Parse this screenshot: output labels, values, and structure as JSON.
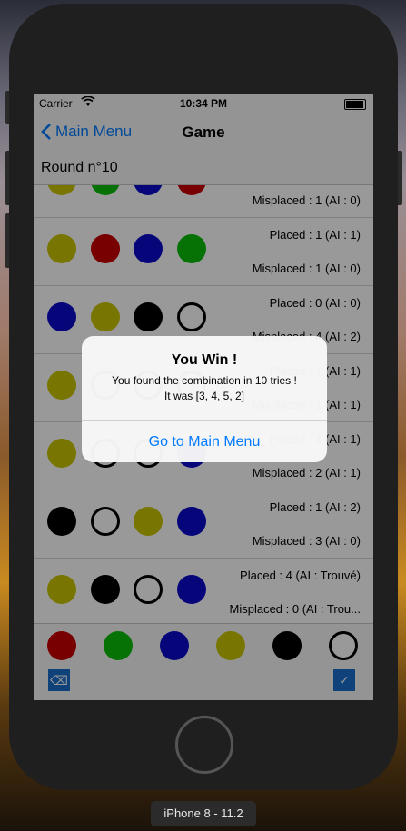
{
  "status_bar": {
    "carrier": "Carrier",
    "time": "10:34 PM"
  },
  "nav": {
    "back_label": "Main Menu",
    "title": "Game"
  },
  "round_label": "Round n°10",
  "colors": {
    "yellow": "#c9c400",
    "green": "#0bbf0b",
    "blue": "#0a0acc",
    "red": "#c80000",
    "black": "#000000",
    "accent": "#007aff"
  },
  "rows": [
    {
      "pegs": [
        "yellow",
        "green",
        "blue",
        "red"
      ],
      "placed": "",
      "misplaced": "Misplaced : 1 (AI : 0)"
    },
    {
      "pegs": [
        "yellow",
        "red",
        "blue",
        "green"
      ],
      "placed": "Placed : 1 (AI : 1)",
      "misplaced": "Misplaced : 1 (AI : 0)"
    },
    {
      "pegs": [
        "blue",
        "yellow",
        "black",
        "empty"
      ],
      "placed": "Placed : 0 (AI : 0)",
      "misplaced": "Misplaced : 4 (AI : 2)"
    },
    {
      "pegs": [
        "yellow",
        "empty",
        "empty",
        "empty"
      ],
      "placed": "Placed : 1 (AI : 1)",
      "misplaced": "Misplaced : 1 (AI : 1)"
    },
    {
      "pegs": [
        "yellow",
        "empty",
        "empty",
        "blue"
      ],
      "placed": "Placed : 1 (AI : 1)",
      "misplaced": "Misplaced : 2 (AI : 1)"
    },
    {
      "pegs": [
        "black",
        "empty",
        "yellow",
        "blue"
      ],
      "placed": "Placed : 1 (AI : 2)",
      "misplaced": "Misplaced : 3 (AI : 0)"
    },
    {
      "pegs": [
        "yellow",
        "black",
        "empty",
        "blue"
      ],
      "placed": "Placed : 4 (AI : Trouvé)",
      "misplaced": "Misplaced : 0 (AI : Trou..."
    }
  ],
  "palette": [
    "red",
    "green",
    "blue",
    "yellow",
    "black",
    "empty"
  ],
  "palette_buttons": {
    "delete": "⌫",
    "confirm": "✓"
  },
  "alert": {
    "title": "You Win !",
    "message_line1": "You found the combination in 10 tries !",
    "message_line2": "It was [3, 4, 5, 2]",
    "button": "Go to Main Menu"
  },
  "device_label": "iPhone 8 - 11.2"
}
